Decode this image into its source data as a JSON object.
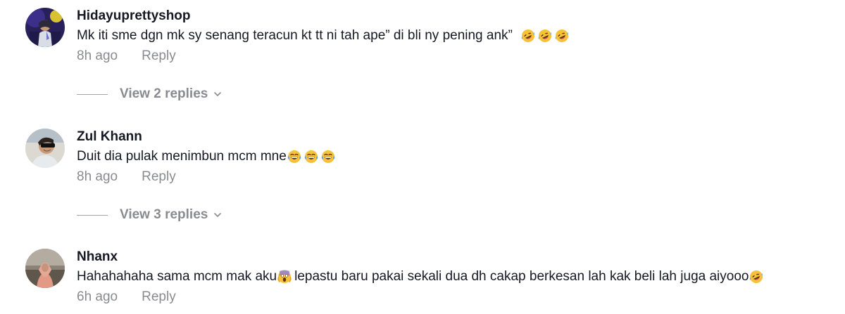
{
  "comments": [
    {
      "username": "Hidayuprettyshop",
      "text": "Mk iti sme dgn mk sy senang teracun kt tt ni tah ape” di bli ny pening ank”",
      "emojis": [
        "rolling-laughing",
        "rolling-laughing",
        "rolling-laughing"
      ],
      "time": "8h ago",
      "reply_label": "Reply",
      "view_replies": "View 2 replies"
    },
    {
      "username": "Zul Khann",
      "text": "Duit dia pulak menimbun mcm mne",
      "emojis": [
        "tears-of-joy",
        "tears-of-joy",
        "tears-of-joy"
      ],
      "time": "8h ago",
      "reply_label": "Reply",
      "view_replies": "View 3 replies"
    },
    {
      "username": "Nhanx",
      "text_before": "Hahahahaha sama mcm mak aku",
      "mid_emoji": "screaming-face",
      "text_after": "lepastu baru pakai sekali dua dh cakap berkesan lah kak beli lah juga aiyooo",
      "end_emoji": "rolling-laughing",
      "time": "6h ago",
      "reply_label": "Reply"
    }
  ],
  "colors": {
    "primary_text": "#161823",
    "secondary_text": "#8a8b91",
    "background": "#ffffff"
  }
}
